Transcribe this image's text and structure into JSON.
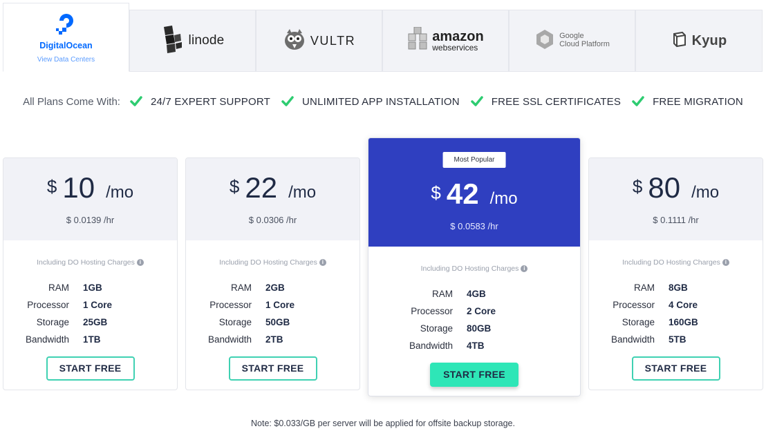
{
  "providers": [
    {
      "name": "DigitalOcean",
      "link": "View Data Centers",
      "active": true,
      "icon": "digitalocean-logo-icon"
    },
    {
      "name": "linode",
      "icon": "linode-logo-icon"
    },
    {
      "name": "VULTR",
      "icon": "vultr-logo-icon"
    },
    {
      "name": "amazon",
      "sub": "webservices",
      "icon": "aws-logo-icon"
    },
    {
      "name": "Google",
      "sub": "Cloud Platform",
      "icon": "gcp-logo-icon"
    },
    {
      "name": "Kyup",
      "icon": "kyup-logo-icon"
    }
  ],
  "features": {
    "lead": "All Plans Come With:",
    "items": [
      "24/7 EXPERT SUPPORT",
      "UNLIMITED APP INSTALLATION",
      "FREE SSL CERTIFICATES",
      "FREE MIGRATION"
    ]
  },
  "plans": [
    {
      "currency": "$",
      "amount": "10",
      "per": "/mo",
      "hourly": "$ 0.0139 /hr",
      "including": "Including DO Hosting Charges",
      "specs": [
        {
          "k": "RAM",
          "v": "1GB"
        },
        {
          "k": "Processor",
          "v": "1 Core"
        },
        {
          "k": "Storage",
          "v": "25GB"
        },
        {
          "k": "Bandwidth",
          "v": "1TB"
        }
      ],
      "button": "START FREE"
    },
    {
      "currency": "$",
      "amount": "22",
      "per": "/mo",
      "hourly": "$ 0.0306 /hr",
      "including": "Including DO Hosting Charges",
      "specs": [
        {
          "k": "RAM",
          "v": "2GB"
        },
        {
          "k": "Processor",
          "v": "1 Core"
        },
        {
          "k": "Storage",
          "v": "50GB"
        },
        {
          "k": "Bandwidth",
          "v": "2TB"
        }
      ],
      "button": "START FREE"
    },
    {
      "badge": "Most Popular",
      "currency": "$",
      "amount": "42",
      "per": "/mo",
      "hourly": "$ 0.0583 /hr",
      "including": "Including DO Hosting Charges",
      "specs": [
        {
          "k": "RAM",
          "v": "4GB"
        },
        {
          "k": "Processor",
          "v": "2 Core"
        },
        {
          "k": "Storage",
          "v": "80GB"
        },
        {
          "k": "Bandwidth",
          "v": "4TB"
        }
      ],
      "button": "START FREE"
    },
    {
      "currency": "$",
      "amount": "80",
      "per": "/mo",
      "hourly": "$ 0.1111 /hr",
      "including": "Including DO Hosting Charges",
      "specs": [
        {
          "k": "RAM",
          "v": "8GB"
        },
        {
          "k": "Processor",
          "v": "4 Core"
        },
        {
          "k": "Storage",
          "v": "160GB"
        },
        {
          "k": "Bandwidth",
          "v": "5TB"
        }
      ],
      "button": "START FREE"
    }
  ],
  "note": "Note: $0.033/GB per server will be applied for offsite backup storage.",
  "colors": {
    "accent": "#2f3fc0",
    "button_border": "#3fd1b2",
    "check": "#2ecc71",
    "do_blue": "#0069ff"
  }
}
